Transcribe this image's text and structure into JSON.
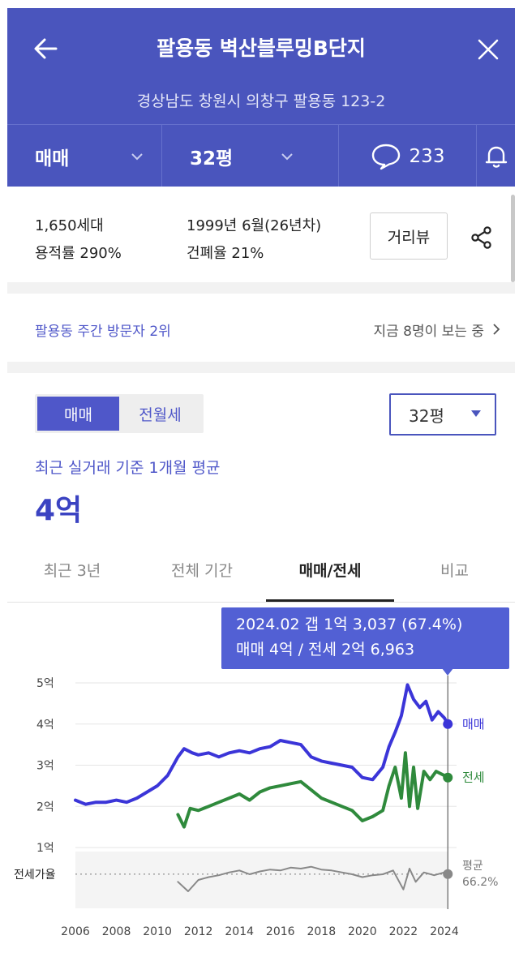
{
  "header": {
    "title": "팔용동 벽산블루밍B단지",
    "address": "경상남도 창원시 의창구 팔용동 123-2",
    "trade_type": "매매",
    "size": "32평",
    "comment_count": "233"
  },
  "info": {
    "households": "1,650세대",
    "floor_area_ratio": "용적률 290%",
    "built": "1999년 6월(26년차)",
    "coverage_ratio": "건폐율 21%",
    "street_view_label": "거리뷰"
  },
  "visitor": {
    "rank_text": "팔용동 주간 방문자 2위",
    "viewers_text": "지금 8명이 보는 중"
  },
  "price": {
    "segment": [
      "매매",
      "전월세"
    ],
    "selected_size": "32평",
    "avg_label": "최근 실거래 기준 1개월 평균",
    "avg_value": "4억",
    "tabs": [
      "최근 3년",
      "전체 기간",
      "매매/전세",
      "비교"
    ]
  },
  "tooltip": {
    "line1": "2024.02  갭 1억 3,037 (67.4%)",
    "line2": "매매 4억 / 전세 2억 6,963"
  },
  "colors": {
    "brand": "#4a55bd",
    "sale": "#3b35d8",
    "jeonse": "#2f8a3c",
    "ratio": "#888888"
  },
  "chart_data": {
    "type": "line",
    "y_tick_labels": [
      "5억",
      "4억",
      "3억",
      "2억",
      "1억"
    ],
    "y_ticks": [
      5,
      4,
      3,
      2,
      1
    ],
    "ylim": [
      1,
      5
    ],
    "x_tick_labels": [
      "2006",
      "2008",
      "2010",
      "2012",
      "2014",
      "2016",
      "2018",
      "2020",
      "2022",
      "2024"
    ],
    "x_ticks": [
      2006,
      2008,
      2010,
      2012,
      2014,
      2016,
      2018,
      2020,
      2022,
      2024
    ],
    "xlim": [
      2006,
      2024.2
    ],
    "ratio_label": "전세가율",
    "series": [
      {
        "name": "매매",
        "x": [
          2006.0,
          2006.5,
          2007.0,
          2007.5,
          2008.0,
          2008.5,
          2009.0,
          2009.5,
          2010.0,
          2010.5,
          2011.0,
          2011.3,
          2011.7,
          2012.0,
          2012.5,
          2013.0,
          2013.5,
          2014.0,
          2014.5,
          2015.0,
          2015.5,
          2016.0,
          2016.5,
          2017.0,
          2017.5,
          2018.0,
          2018.5,
          2019.0,
          2019.5,
          2020.0,
          2020.5,
          2021.0,
          2021.3,
          2021.6,
          2021.9,
          2022.2,
          2022.5,
          2022.8,
          2023.1,
          2023.4,
          2023.7,
          2024.0,
          2024.17
        ],
        "y": [
          2.15,
          2.05,
          2.1,
          2.1,
          2.15,
          2.1,
          2.2,
          2.35,
          2.5,
          2.75,
          3.2,
          3.4,
          3.3,
          3.25,
          3.3,
          3.2,
          3.3,
          3.35,
          3.3,
          3.4,
          3.45,
          3.6,
          3.55,
          3.5,
          3.2,
          3.1,
          3.05,
          3.0,
          2.95,
          2.7,
          2.65,
          2.95,
          3.45,
          3.8,
          4.2,
          4.95,
          4.6,
          4.4,
          4.55,
          4.1,
          4.3,
          4.15,
          4.0
        ]
      },
      {
        "name": "전세",
        "x": [
          2011.0,
          2011.3,
          2011.6,
          2012.0,
          2012.5,
          2013.0,
          2013.5,
          2014.0,
          2014.5,
          2015.0,
          2015.5,
          2016.0,
          2016.5,
          2017.0,
          2017.5,
          2018.0,
          2018.5,
          2019.0,
          2019.5,
          2020.0,
          2020.5,
          2021.0,
          2021.3,
          2021.6,
          2021.9,
          2022.1,
          2022.3,
          2022.5,
          2022.7,
          2023.0,
          2023.3,
          2023.6,
          2024.0,
          2024.17
        ],
        "y": [
          1.8,
          1.5,
          1.95,
          1.9,
          2.0,
          2.1,
          2.2,
          2.3,
          2.15,
          2.35,
          2.45,
          2.5,
          2.55,
          2.6,
          2.4,
          2.2,
          2.1,
          2.0,
          1.9,
          1.65,
          1.75,
          1.9,
          2.5,
          2.95,
          2.2,
          3.3,
          2.0,
          2.95,
          1.95,
          2.85,
          2.65,
          2.85,
          2.75,
          2.7
        ]
      },
      {
        "name": "평균",
        "x": [
          2011.0,
          2011.5,
          2012.0,
          2012.5,
          2013.0,
          2013.5,
          2014.0,
          2014.5,
          2015.0,
          2015.5,
          2016.0,
          2016.5,
          2017.0,
          2017.5,
          2018.0,
          2018.5,
          2019.0,
          2019.5,
          2020.0,
          2020.5,
          2021.0,
          2021.5,
          2022.0,
          2022.3,
          2022.6,
          2023.0,
          2023.5,
          2024.0,
          2024.17
        ],
        "y": [
          0.58,
          0.48,
          0.6,
          0.63,
          0.65,
          0.68,
          0.7,
          0.66,
          0.69,
          0.71,
          0.7,
          0.73,
          0.72,
          0.74,
          0.71,
          0.7,
          0.68,
          0.66,
          0.63,
          0.65,
          0.66,
          0.7,
          0.5,
          0.72,
          0.58,
          0.68,
          0.65,
          0.68,
          0.662
        ]
      }
    ],
    "end_labels": {
      "sale": "매매",
      "jeonse": "전세",
      "ratio": "평균",
      "ratio_value": "66.2%"
    },
    "cursor_x": 2024.17
  }
}
